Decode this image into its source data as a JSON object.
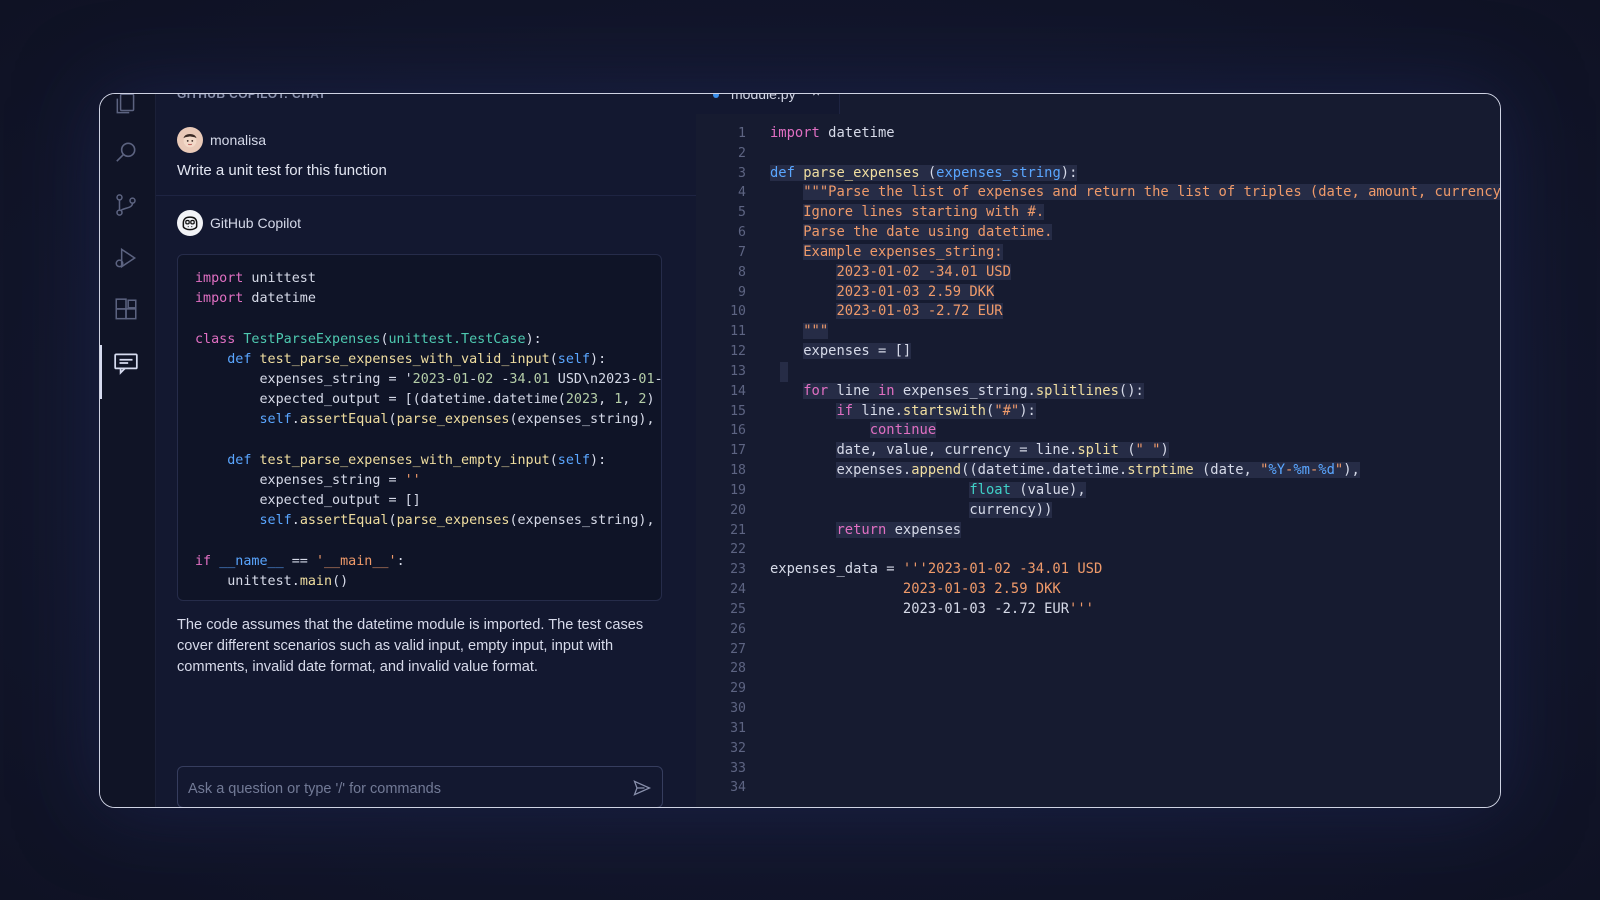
{
  "activity_bar": {
    "icons": [
      "files-icon",
      "search-icon",
      "source-control-icon",
      "run-debug-icon",
      "extensions-icon",
      "chat-icon"
    ]
  },
  "chat": {
    "title": "GITHUB COPILOT: CHAT",
    "user": {
      "name": "monalisa",
      "message": "Write a unit test for this function"
    },
    "bot": {
      "name": "GitHub Copilot",
      "code_lines": [
        "import unittest",
        "import datetime",
        "",
        "class TestParseExpenses(unittest.TestCase):",
        "    def test_parse_expenses_with_valid_input(self):",
        "        expenses_string = '2023-01-02 -34.01 USD\\n2023-01-",
        "        expected_output = [(datetime.datetime(2023, 1, 2)",
        "        self.assertEqual(parse_expenses(expenses_string),",
        "",
        "    def test_parse_expenses_with_empty_input(self):",
        "        expenses_string = ''",
        "        expected_output = []",
        "        self.assertEqual(parse_expenses(expenses_string),",
        "",
        "if __name__ == '__main__':",
        "    unittest.main()"
      ],
      "explanation": "The code assumes that the datetime module is imported. The test cases cover different scenarios such as valid input, empty input, input with comments, invalid date format, and invalid value format."
    },
    "input": {
      "placeholder": "Ask a question or type '/' for commands",
      "value": ""
    }
  },
  "editor": {
    "tab": {
      "filename": "module.py",
      "close": "×"
    },
    "line_numbers": [
      "1",
      "2",
      "3",
      "4",
      "5",
      "6",
      "7",
      "8",
      "9",
      "10",
      "11",
      "12",
      "13",
      "14",
      "15",
      "16",
      "17",
      "18",
      "19",
      "20",
      "21",
      "22",
      "23",
      "24",
      "25",
      "26",
      "27",
      "28",
      "29",
      "30",
      "31",
      "32",
      "33",
      "34"
    ],
    "code_lines": [
      "import datetime",
      "",
      "def parse_expenses (expenses_string):",
      "    \"\"\"Parse the list of expenses and return the list of triples (date, amount, currency",
      "    Ignore lines starting with #.",
      "    Parse the date using datetime.",
      "    Example expenses_string:",
      "        2023-01-02 -34.01 USD",
      "        2023-01-03 2.59 DKK",
      "        2023-01-03 -2.72 EUR",
      "    \"\"\"",
      "    expenses = []",
      "",
      "    for line in expenses_string.splitlines():",
      "        if line.startswith(\"#\"):",
      "            continue",
      "        date, value, currency = line.split (\" \")",
      "        expenses.append((datetime.datetime.strptime (date, \"%Y-%m-%d\"),",
      "                        float (value),",
      "                        currency))",
      "        return expenses",
      "",
      "expenses_data = '''2023-01-02 -34.01 USD",
      "                2023-01-03 2.59 DKK",
      "                2023-01-03 -2.72 EUR'''",
      "",
      "",
      "",
      "",
      "",
      "",
      "",
      "",
      ""
    ]
  },
  "colors": {
    "background": "#13172d",
    "keyword": "#e06fc2",
    "string": "#ef9a6a",
    "function": "#f0dea0",
    "class": "#4ec9b0",
    "highlight": "#262c46"
  }
}
